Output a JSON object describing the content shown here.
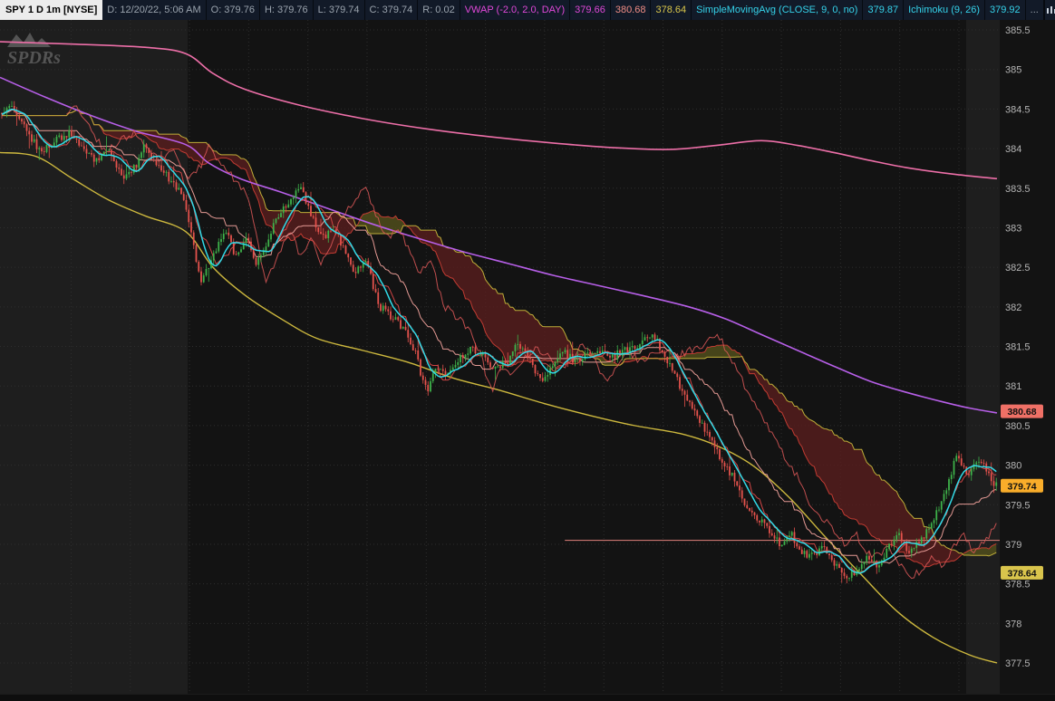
{
  "toolbar": {
    "symbol": "SPY 1 D 1m [NYSE]",
    "fields": [
      {
        "label": "D: 12/20/22, 5:06 AM"
      },
      {
        "label": "O: 379.76"
      },
      {
        "label": "H: 379.76"
      },
      {
        "label": "L: 379.74"
      },
      {
        "label": "C: 379.74"
      },
      {
        "label": "R: 0.02"
      }
    ],
    "studies": [
      {
        "label": "VWAP (-2.0, 2.0, DAY)",
        "color": "#e048d8"
      },
      {
        "label": "379.66",
        "color": "#e048d8"
      },
      {
        "label": "380.68",
        "color": "#f08d85"
      },
      {
        "label": "378.64",
        "color": "#d9c64b"
      },
      {
        "label": "SimpleMovingAvg (CLOSE, 9, 0, no)",
        "color": "#35d2ea"
      },
      {
        "label": "379.87",
        "color": "#35d2ea"
      },
      {
        "label": "Ichimoku (9, 26)",
        "color": "#35d2ea"
      },
      {
        "label": "379.92",
        "color": "#35d2ea"
      },
      {
        "label": "...",
        "color": "#9aa3ad"
      }
    ]
  },
  "watermark": "SPDRs",
  "price_badges": [
    {
      "value": "380.68",
      "price": 380.68,
      "bg": "#ef7066",
      "fg": "#111111"
    },
    {
      "value": "379.74",
      "price": 379.74,
      "bg": "#f9ad2a",
      "fg": "#111111"
    },
    {
      "value": "378.64",
      "price": 378.64,
      "bg": "#d9c44c",
      "fg": "#111111"
    }
  ],
  "colors": {
    "bg": "#131313",
    "session_band": "#1e1e1e",
    "grid": "#2e2e2e",
    "axis_text": "#b4b4b4",
    "candle_up": "#3eb24a",
    "candle_down": "#e4524c",
    "sma": "#30dbe8",
    "vwap": "#b75fe8",
    "vwap_upper": "#ed6fa8",
    "vwap_lower": "#cdb83e",
    "tenkan": "#cf4545",
    "kijun": "#e59a94",
    "span_a": "#c13b32",
    "span_b": "#bfae39",
    "cloud_bull": "#55521c",
    "cloud_bear": "#5a1d1d",
    "lagging": "#dd5858",
    "level_line": "#e2837d",
    "watermark": "#969696",
    "scrollbar": "#0e0e0e"
  },
  "chart_data": {
    "type": "candlestick",
    "title": "SPY 1 D 1m [NYSE]",
    "last_bar": {
      "open": 379.76,
      "high": 379.76,
      "low": 379.74,
      "close": 379.74,
      "range": 0.02
    },
    "price_axis": {
      "min": 377.0,
      "max": 385.63,
      "tick_step": 0.5,
      "ticks": [
        385.5,
        385,
        384.5,
        384,
        383.5,
        383,
        382.5,
        382,
        381.5,
        381,
        380.5,
        380,
        379.5,
        379,
        378.5,
        378,
        377.5
      ]
    },
    "close_anchors": [
      [
        0,
        384.45
      ],
      [
        14,
        384.55
      ],
      [
        28,
        384.25
      ],
      [
        45,
        383.95
      ],
      [
        60,
        384.1
      ],
      [
        76,
        384.2
      ],
      [
        92,
        384.0
      ],
      [
        106,
        383.85
      ],
      [
        120,
        383.95
      ],
      [
        136,
        383.6
      ],
      [
        150,
        383.78
      ],
      [
        160,
        384.08
      ],
      [
        168,
        383.88
      ],
      [
        184,
        383.65
      ],
      [
        200,
        383.42
      ],
      [
        208,
        383.12
      ],
      [
        215,
        382.66
      ],
      [
        223,
        382.3
      ],
      [
        236,
        382.7
      ],
      [
        250,
        382.95
      ],
      [
        261,
        382.6
      ],
      [
        272,
        382.9
      ],
      [
        283,
        382.55
      ],
      [
        294,
        382.82
      ],
      [
        306,
        383.12
      ],
      [
        318,
        383.32
      ],
      [
        330,
        383.55
      ],
      [
        342,
        383.2
      ],
      [
        355,
        382.85
      ],
      [
        368,
        382.98
      ],
      [
        380,
        382.72
      ],
      [
        392,
        382.42
      ],
      [
        404,
        382.58
      ],
      [
        418,
        382.02
      ],
      [
        432,
        381.88
      ],
      [
        445,
        381.72
      ],
      [
        458,
        381.45
      ],
      [
        466,
        381.08
      ],
      [
        472,
        380.96
      ],
      [
        482,
        381.25
      ],
      [
        495,
        381.15
      ],
      [
        508,
        381.36
      ],
      [
        520,
        381.5
      ],
      [
        534,
        381.35
      ],
      [
        548,
        381.2
      ],
      [
        560,
        381.32
      ],
      [
        572,
        381.55
      ],
      [
        585,
        381.3
      ],
      [
        598,
        381.05
      ],
      [
        610,
        381.26
      ],
      [
        622,
        381.42
      ],
      [
        635,
        381.3
      ],
      [
        648,
        381.38
      ],
      [
        660,
        381.46
      ],
      [
        672,
        381.36
      ],
      [
        685,
        381.42
      ],
      [
        698,
        381.5
      ],
      [
        710,
        381.56
      ],
      [
        722,
        381.62
      ],
      [
        735,
        381.35
      ],
      [
        748,
        381.05
      ],
      [
        760,
        380.8
      ],
      [
        772,
        380.55
      ],
      [
        785,
        380.35
      ],
      [
        798,
        380.0
      ],
      [
        810,
        379.85
      ],
      [
        822,
        379.5
      ],
      [
        835,
        379.35
      ],
      [
        848,
        379.18
      ],
      [
        860,
        379.0
      ],
      [
        872,
        379.15
      ],
      [
        884,
        378.9
      ],
      [
        896,
        378.85
      ],
      [
        908,
        378.96
      ],
      [
        920,
        378.74
      ],
      [
        932,
        378.6
      ],
      [
        944,
        378.66
      ],
      [
        956,
        378.86
      ],
      [
        968,
        378.7
      ],
      [
        980,
        378.95
      ],
      [
        992,
        379.1
      ],
      [
        1004,
        378.9
      ],
      [
        1016,
        379.05
      ],
      [
        1028,
        379.25
      ],
      [
        1040,
        379.55
      ],
      [
        1050,
        379.9
      ],
      [
        1056,
        380.18
      ],
      [
        1062,
        379.95
      ],
      [
        1070,
        379.9
      ],
      [
        1078,
        380.05
      ],
      [
        1088,
        379.95
      ],
      [
        1097,
        379.74
      ]
    ],
    "overlays": {
      "vwap": {
        "label": "VWAP (-2.0, 2.0, DAY)",
        "value": 379.66,
        "upper": 380.68,
        "lower": 378.64,
        "vwap_anchors": [
          [
            0,
            384.9
          ],
          [
            50,
            384.65
          ],
          [
            100,
            384.42
          ],
          [
            150,
            384.22
          ],
          [
            205,
            384.05
          ],
          [
            230,
            383.82
          ],
          [
            265,
            383.62
          ],
          [
            310,
            383.45
          ],
          [
            360,
            383.25
          ],
          [
            410,
            383.05
          ],
          [
            460,
            382.87
          ],
          [
            510,
            382.7
          ],
          [
            560,
            382.55
          ],
          [
            610,
            382.4
          ],
          [
            660,
            382.27
          ],
          [
            710,
            382.14
          ],
          [
            760,
            382.0
          ],
          [
            800,
            381.85
          ],
          [
            840,
            381.65
          ],
          [
            880,
            381.45
          ],
          [
            920,
            381.25
          ],
          [
            960,
            381.06
          ],
          [
            1000,
            380.92
          ],
          [
            1040,
            380.8
          ],
          [
            1070,
            380.72
          ],
          [
            1100,
            380.66
          ]
        ],
        "upper_anchors": [
          [
            0,
            385.35
          ],
          [
            80,
            385.32
          ],
          [
            160,
            385.28
          ],
          [
            205,
            385.2
          ],
          [
            235,
            384.95
          ],
          [
            270,
            384.75
          ],
          [
            330,
            384.55
          ],
          [
            400,
            384.38
          ],
          [
            470,
            384.25
          ],
          [
            540,
            384.15
          ],
          [
            610,
            384.07
          ],
          [
            680,
            384.01
          ],
          [
            740,
            383.99
          ],
          [
            790,
            384.04
          ],
          [
            840,
            384.1
          ],
          [
            880,
            384.04
          ],
          [
            920,
            383.95
          ],
          [
            960,
            383.85
          ],
          [
            1000,
            383.76
          ],
          [
            1050,
            383.68
          ],
          [
            1100,
            383.62
          ]
        ],
        "lower_anchors": [
          [
            0,
            383.95
          ],
          [
            40,
            383.9
          ],
          [
            80,
            383.62
          ],
          [
            120,
            383.35
          ],
          [
            160,
            383.15
          ],
          [
            205,
            382.95
          ],
          [
            235,
            382.5
          ],
          [
            270,
            382.15
          ],
          [
            310,
            381.85
          ],
          [
            350,
            381.6
          ],
          [
            400,
            381.45
          ],
          [
            450,
            381.3
          ],
          [
            500,
            381.1
          ],
          [
            550,
            380.95
          ],
          [
            600,
            380.78
          ],
          [
            650,
            380.63
          ],
          [
            700,
            380.5
          ],
          [
            750,
            380.4
          ],
          [
            790,
            380.25
          ],
          [
            830,
            380.0
          ],
          [
            870,
            379.6
          ],
          [
            910,
            379.1
          ],
          [
            950,
            378.62
          ],
          [
            990,
            378.15
          ],
          [
            1030,
            377.82
          ],
          [
            1070,
            377.6
          ],
          [
            1100,
            377.5
          ]
        ]
      },
      "sma": {
        "label": "SimpleMovingAvg (CLOSE, 9, 0, no)",
        "value": 379.87,
        "period": 9
      },
      "ichimoku": {
        "label": "Ichimoku (9, 26)",
        "value": 379.92,
        "tenkan": 9,
        "kijun": 26,
        "senkou_b": 52,
        "shift": 26
      },
      "level_line": {
        "price": 379.05,
        "start_frac": 0.565
      }
    },
    "render": {
      "seed": 9,
      "bar_spacing": 2.75,
      "noise": 0.05,
      "wick": 0.07,
      "session_bands": [
        [
          0,
          207
        ],
        [
          1066,
          1103
        ]
      ],
      "vgrid_start": 78,
      "vgrid_step": 65.3
    }
  }
}
